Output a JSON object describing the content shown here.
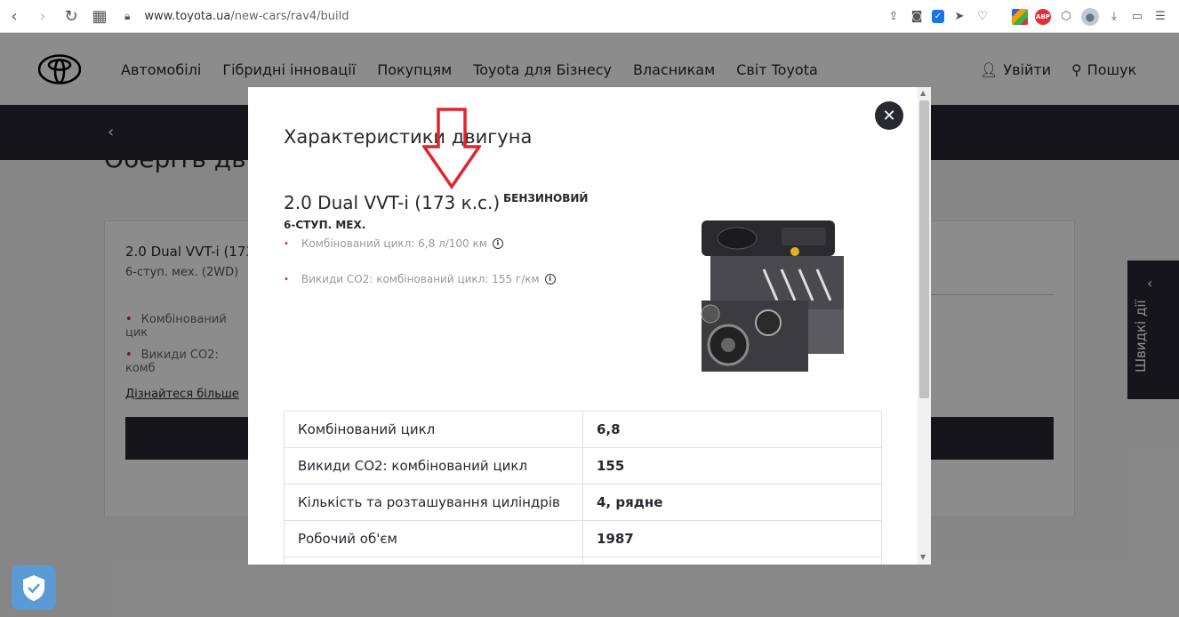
{
  "browser": {
    "url_domain": "www.toyota.ua",
    "url_path": "/new-cars/rav4/build",
    "extensions": [
      "share-icon",
      "camera-icon",
      "shield-extension-icon",
      "send-icon",
      "heart-icon",
      "tile-extension-icon",
      "adblock-icon",
      "cube-icon",
      "profile-avatar",
      "download-icon",
      "battery-icon",
      "menu-icon"
    ],
    "abp_label": "ABP"
  },
  "header": {
    "nav": [
      "Автомобілі",
      "Гібридні інновації",
      "Покупцям",
      "Toyota для Бізнесу",
      "Власникам",
      "Світ Toyota"
    ],
    "login": "Увійти",
    "search": "Пошук"
  },
  "background": {
    "partial_title": "Оберіть дви",
    "card_title": "2.0 Dual VVT-i (173",
    "card_sub": "6-ступ. мех. (2WD)",
    "card_line1": "Комбінований цик",
    "card_line2": "Викиди CO2: комб",
    "learn_more": "Дізнайтеся більше",
    "quick_actions": "Швидкі дії"
  },
  "modal": {
    "title": "Характеристики двигуна",
    "engine_name": "2.0 Dual VVT-i (173 к.с.)",
    "fuel_type": "БЕНЗИНОВИЙ",
    "transmission": "6-СТУП. МЕХ.",
    "specs": [
      "Комбінований цикл: 6,8 л/100 км",
      "Викиди CO2: комбінований цикл: 155 г/км"
    ],
    "table": [
      {
        "key": "Комбінований цикл",
        "value": "6,8"
      },
      {
        "key": "Викиди CO2: комбінований цикл",
        "value": "155"
      },
      {
        "key": "Кількість та розташування циліндрів",
        "value": "4, рядне"
      },
      {
        "key": "Робочий об'єм",
        "value": "1987"
      },
      {
        "key": "",
        "value": ""
      }
    ]
  },
  "colors": {
    "dark": "#282830",
    "accent_red": "#d01c2a",
    "annotation_red": "#e3242b"
  }
}
